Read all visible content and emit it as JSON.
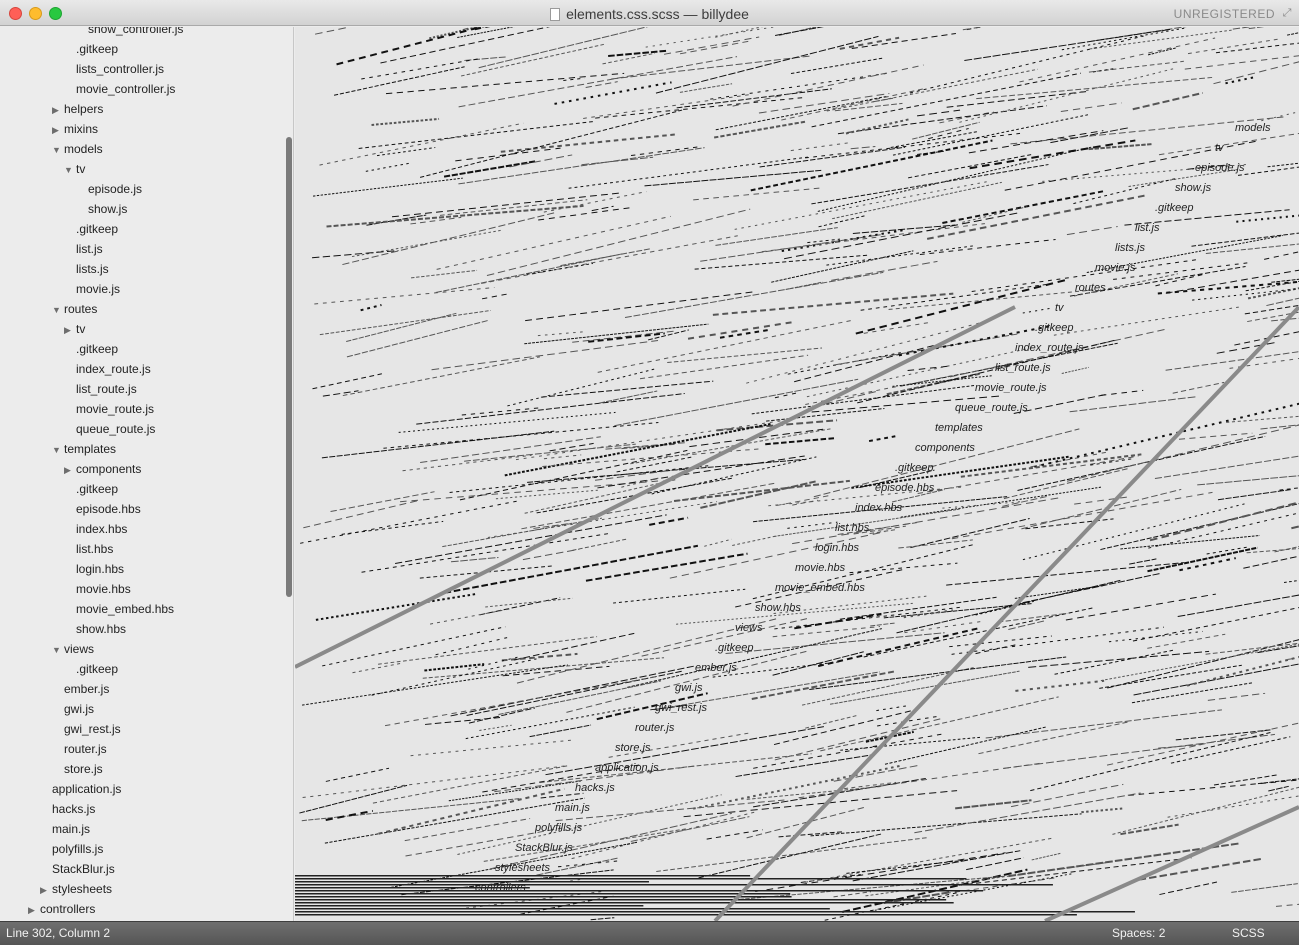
{
  "window": {
    "title": "elements.css.scss — billydee",
    "unregistered": "UNREGISTERED"
  },
  "sidebar": {
    "rows": [
      {
        "label": "show_controller.js",
        "level": 4,
        "type": "file"
      },
      {
        "label": ".gitkeep",
        "level": 3,
        "type": "file"
      },
      {
        "label": "lists_controller.js",
        "level": 3,
        "type": "file"
      },
      {
        "label": "movie_controller.js",
        "level": 3,
        "type": "file"
      },
      {
        "label": "helpers",
        "level": 2,
        "type": "folder",
        "expanded": false
      },
      {
        "label": "mixins",
        "level": 2,
        "type": "folder",
        "expanded": false
      },
      {
        "label": "models",
        "level": 2,
        "type": "folder",
        "expanded": true
      },
      {
        "label": "tv",
        "level": 3,
        "type": "folder",
        "expanded": true
      },
      {
        "label": "episode.js",
        "level": 4,
        "type": "file"
      },
      {
        "label": "show.js",
        "level": 4,
        "type": "file"
      },
      {
        "label": ".gitkeep",
        "level": 3,
        "type": "file"
      },
      {
        "label": "list.js",
        "level": 3,
        "type": "file"
      },
      {
        "label": "lists.js",
        "level": 3,
        "type": "file"
      },
      {
        "label": "movie.js",
        "level": 3,
        "type": "file"
      },
      {
        "label": "routes",
        "level": 2,
        "type": "folder",
        "expanded": true
      },
      {
        "label": "tv",
        "level": 3,
        "type": "folder",
        "expanded": false
      },
      {
        "label": ".gitkeep",
        "level": 3,
        "type": "file"
      },
      {
        "label": "index_route.js",
        "level": 3,
        "type": "file"
      },
      {
        "label": "list_route.js",
        "level": 3,
        "type": "file"
      },
      {
        "label": "movie_route.js",
        "level": 3,
        "type": "file"
      },
      {
        "label": "queue_route.js",
        "level": 3,
        "type": "file"
      },
      {
        "label": "templates",
        "level": 2,
        "type": "folder",
        "expanded": true
      },
      {
        "label": "components",
        "level": 3,
        "type": "folder",
        "expanded": false
      },
      {
        "label": ".gitkeep",
        "level": 3,
        "type": "file"
      },
      {
        "label": "episode.hbs",
        "level": 3,
        "type": "file"
      },
      {
        "label": "index.hbs",
        "level": 3,
        "type": "file"
      },
      {
        "label": "list.hbs",
        "level": 3,
        "type": "file"
      },
      {
        "label": "login.hbs",
        "level": 3,
        "type": "file"
      },
      {
        "label": "movie.hbs",
        "level": 3,
        "type": "file"
      },
      {
        "label": "movie_embed.hbs",
        "level": 3,
        "type": "file"
      },
      {
        "label": "show.hbs",
        "level": 3,
        "type": "file"
      },
      {
        "label": "views",
        "level": 2,
        "type": "folder",
        "expanded": true
      },
      {
        "label": ".gitkeep",
        "level": 3,
        "type": "file"
      },
      {
        "label": "ember.js",
        "level": 2,
        "type": "file"
      },
      {
        "label": "gwi.js",
        "level": 2,
        "type": "file"
      },
      {
        "label": "gwi_rest.js",
        "level": 2,
        "type": "file"
      },
      {
        "label": "router.js",
        "level": 2,
        "type": "file"
      },
      {
        "label": "store.js",
        "level": 2,
        "type": "file"
      },
      {
        "label": "application.js",
        "level": 1,
        "type": "file"
      },
      {
        "label": "hacks.js",
        "level": 1,
        "type": "file"
      },
      {
        "label": "main.js",
        "level": 1,
        "type": "file"
      },
      {
        "label": "polyfills.js",
        "level": 1,
        "type": "file"
      },
      {
        "label": "StackBlur.js",
        "level": 1,
        "type": "file"
      },
      {
        "label": "stylesheets",
        "level": 1,
        "type": "folder",
        "expanded": false
      },
      {
        "label": "controllers",
        "level": 0,
        "type": "folder",
        "expanded": false
      }
    ]
  },
  "editor": {
    "glitch_labels": [
      "models",
      "tv",
      "episode.js",
      "show.js",
      ".gitkeep",
      "list.js",
      "lists.js",
      "movie.js",
      "routes",
      "tv",
      ".gitkeep",
      "index_route.js",
      "list_route.js",
      "movie_route.js",
      "queue_route.js",
      "templates",
      "components",
      ".gitkeep",
      "episode.hbs",
      "index.hbs",
      "list.hbs",
      "login.hbs",
      "movie.hbs",
      "movie_embed.hbs",
      "show.hbs",
      "views",
      ".gitkeep",
      "ember.js",
      "gwi.js",
      "gwi_rest.js",
      "router.js",
      "store.js",
      "application.js",
      "hacks.js",
      "main.js",
      "polyfills.js",
      "StackBlur.js",
      "stylesheets",
      "controllers"
    ]
  },
  "statusbar": {
    "position": "Line 302, Column 2",
    "indent": "Spaces: 2",
    "syntax": "SCSS"
  },
  "colors": {
    "sidebar_bg": "#ececec",
    "editor_bg": "#e6e6e6",
    "statusbar_bg": "#5e5e5e"
  }
}
